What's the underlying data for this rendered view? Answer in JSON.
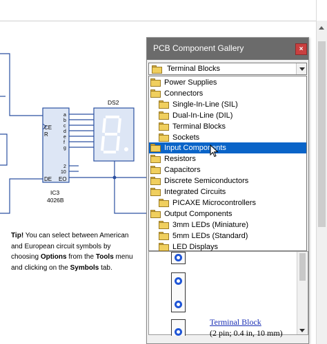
{
  "gallery": {
    "title": "PCB Component Gallery",
    "close_label": "×",
    "selected_category": "Terminal Blocks",
    "categories": [
      {
        "label": "Power Supplies",
        "level": 0
      },
      {
        "label": "Connectors",
        "level": 0
      },
      {
        "label": "Single-In-Line (SIL)",
        "level": 1
      },
      {
        "label": "Dual-In-Line (DIL)",
        "level": 1
      },
      {
        "label": "Terminal Blocks",
        "level": 1
      },
      {
        "label": "Sockets",
        "level": 1
      },
      {
        "label": "Input Components",
        "level": 0,
        "highlighted": true
      },
      {
        "label": "Resistors",
        "level": 0
      },
      {
        "label": "Capacitors",
        "level": 0
      },
      {
        "label": "Discrete Semiconductors",
        "level": 0
      },
      {
        "label": "Integrated Circuits",
        "level": 0
      },
      {
        "label": "PICAXE Microcontrollers",
        "level": 1
      },
      {
        "label": "Output Components",
        "level": 0
      },
      {
        "label": "3mm LEDs (Miniature)",
        "level": 1
      },
      {
        "label": "5mm LEDs (Standard)",
        "level": 1
      },
      {
        "label": "LED Displays",
        "level": 1
      }
    ],
    "preview": {
      "link": "Terminal Block",
      "description": "(2 pin; 0.4 in, 10 mm)"
    }
  },
  "schematic": {
    "display_label": "DS2",
    "ic_name": "IC3",
    "ic_part": "4026B",
    "ic_left_pins": [
      "CE",
      "R",
      "DE"
    ],
    "ic_right_pins": [
      "a",
      "b",
      "c",
      "d",
      "e",
      "f",
      "g",
      "2",
      "10",
      "EO"
    ],
    "digit": "8."
  },
  "tip": {
    "heading": "Tip!",
    "t1": " You can select between American and European circuit symbols by choosing ",
    "b1": "Options",
    "t2": " from the ",
    "b2": "Tools",
    "t3": " menu and clicking on the ",
    "b3": "Symbols",
    "t4": " tab."
  },
  "colors": {
    "wire": "#2a4fa0",
    "chip_fill": "#dde6f5",
    "selection": "#0a64c8",
    "title_bar": "#6b6b6b",
    "close_button": "#c94040"
  },
  "icons": [
    "folder-icon",
    "close-icon",
    "dropdown-arrow-icon",
    "mouse-pointer-icon"
  ]
}
